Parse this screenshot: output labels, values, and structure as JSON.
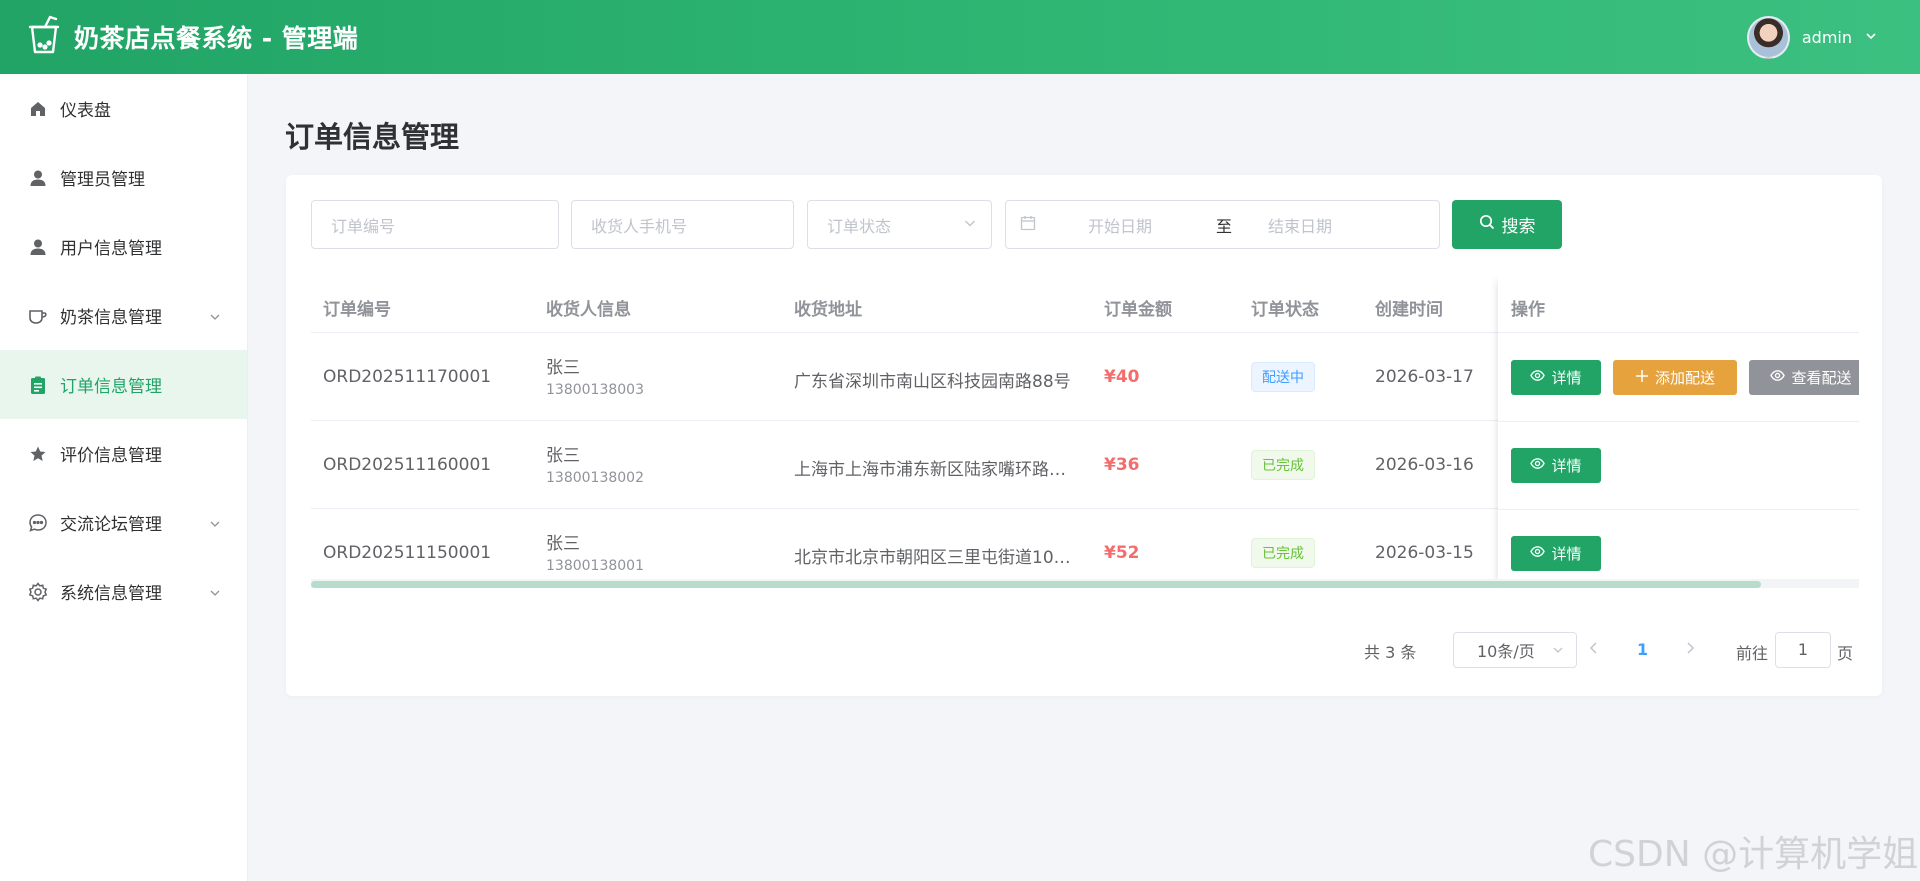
{
  "header": {
    "title": "奶茶店点餐系统 - 管理端",
    "user_name": "admin"
  },
  "sidebar": {
    "items": [
      {
        "label": "仪表盘",
        "icon": "home-icon"
      },
      {
        "label": "管理员管理",
        "icon": "user-icon"
      },
      {
        "label": "用户信息管理",
        "icon": "user-icon"
      },
      {
        "label": "奶茶信息管理",
        "icon": "cup-icon",
        "expandable": true
      },
      {
        "label": "订单信息管理",
        "icon": "clipboard-icon",
        "active": true
      },
      {
        "label": "评价信息管理",
        "icon": "star-icon"
      },
      {
        "label": "交流论坛管理",
        "icon": "chat-icon",
        "expandable": true
      },
      {
        "label": "系统信息管理",
        "icon": "gear-icon",
        "expandable": true
      }
    ]
  },
  "page": {
    "title": "订单信息管理"
  },
  "filters": {
    "order_no_placeholder": "订单编号",
    "phone_placeholder": "收货人手机号",
    "status_placeholder": "订单状态",
    "date_start_placeholder": "开始日期",
    "date_separator": "至",
    "date_end_placeholder": "结束日期",
    "search_label": "搜索"
  },
  "table": {
    "columns": [
      "订单编号",
      "收货人信息",
      "收货地址",
      "订单金额",
      "订单状态",
      "创建时间",
      "操作"
    ],
    "rows": [
      {
        "order_no": "ORD202511170001",
        "name": "张三",
        "phone": "13800138003",
        "address": "广东省深圳市南山区科技园南路88号",
        "amount": "¥40",
        "status": "配送中",
        "status_color": "#409eff",
        "created": "2026-03-17",
        "actions": [
          "详情",
          "添加配送",
          "查看配送"
        ]
      },
      {
        "order_no": "ORD202511160001",
        "name": "张三",
        "phone": "13800138002",
        "address": "上海市上海市浦东新区陆家嘴环路…",
        "amount": "¥36",
        "status": "已完成",
        "status_color": "#67c23a",
        "created": "2026-03-16",
        "actions": [
          "详情"
        ]
      },
      {
        "order_no": "ORD202511150001",
        "name": "张三",
        "phone": "13800138001",
        "address": "北京市北京市朝阳区三里屯街道10…",
        "amount": "¥52",
        "status": "已完成",
        "status_color": "#67c23a",
        "created": "2026-03-15",
        "actions": [
          "详情"
        ]
      }
    ]
  },
  "pagination": {
    "total": "共 3 条",
    "page_size": "10条/页",
    "current_page": "1",
    "goto_label": "前往",
    "goto_value": "1",
    "page_suffix": "页"
  },
  "watermark": "CSDN @计算机学姐",
  "colors": {
    "primary": "#21a466",
    "warning": "#e6a23c",
    "info": "#909399",
    "danger": "#f56c6c",
    "blue": "#409eff"
  }
}
